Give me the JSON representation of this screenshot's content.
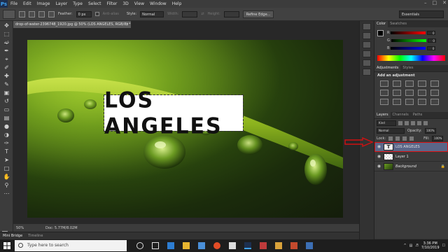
{
  "app": {
    "logo": "Ps"
  },
  "menu": [
    "File",
    "Edit",
    "Image",
    "Layer",
    "Type",
    "Select",
    "Filter",
    "3D",
    "View",
    "Window",
    "Help"
  ],
  "options": {
    "feather_label": "Feather:",
    "feather_value": "0 px",
    "antialias_label": "Anti-alias",
    "style_label": "Style:",
    "style_value": "Normal",
    "width_label": "Width:",
    "height_label": "Height:",
    "refine_label": "Refine Edge...",
    "workspace_value": "Essentials"
  },
  "document": {
    "tab_title": "drop-of-water-2396748_1920.jpg @ 50% (LOS ANGELES, RGB/8) *",
    "canvas_text": "LOS ANGELES",
    "zoom": "50%",
    "doc_info": "Doc: 5.77M/8.02M"
  },
  "bottom_tabs": {
    "mini_bridge": "Mini Bridge",
    "timeline": "Timeline"
  },
  "color_panel": {
    "tabs": [
      "Color",
      "Swatches"
    ],
    "channels": [
      {
        "label": "R",
        "value": "0"
      },
      {
        "label": "G",
        "value": "0"
      },
      {
        "label": "B",
        "value": "0"
      }
    ]
  },
  "adjustments_panel": {
    "tabs": [
      "Adjustments",
      "Styles"
    ],
    "title": "Add an adjustment"
  },
  "layers_panel": {
    "tabs": [
      "Layers",
      "Channels",
      "Paths"
    ],
    "kind_label": "Kind",
    "blend_mode": "Normal",
    "opacity_label": "Opacity:",
    "opacity_value": "100%",
    "lock_label": "Lock:",
    "fill_label": "Fill:",
    "fill_value": "100%",
    "layers": [
      {
        "name": "LOS ANGELES",
        "thumb": "T",
        "selected": true
      },
      {
        "name": "Layer 1",
        "thumb": "",
        "selected": false
      },
      {
        "name": "Background",
        "thumb": "",
        "selected": false
      }
    ]
  },
  "taskbar": {
    "search_placeholder": "Type here to search",
    "time": "3:36 PM",
    "date": "7/10/2019"
  },
  "colors": {
    "accent_selection": "#5a6688",
    "annotation_red": "#d11111",
    "canvas_text_bg": "#ffffff"
  }
}
